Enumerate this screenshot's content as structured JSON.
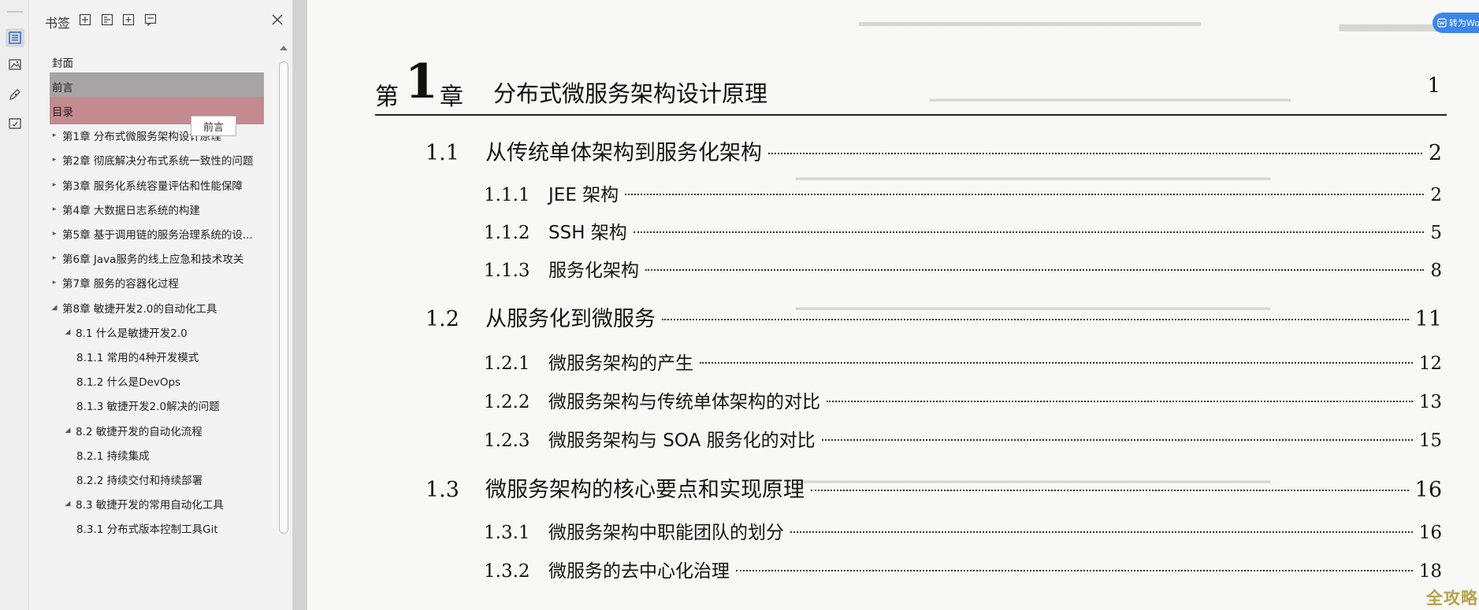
{
  "rail": {
    "icons": [
      "bookmark-outline-icon",
      "thumbnail-icon",
      "annotation-icon",
      "attachment-icon"
    ]
  },
  "bookmarks": {
    "title": "书签",
    "header_icons": [
      "expand-all-icon",
      "collapse-all-icon",
      "add-bookmark-icon",
      "bookmark-options-icon",
      "close-icon"
    ],
    "tooltip": "前言",
    "items": [
      {
        "label": "封面",
        "level": 0,
        "arrow": "",
        "state": "normal"
      },
      {
        "label": "前言",
        "level": 0,
        "arrow": "",
        "state": "highlighted"
      },
      {
        "label": "目录",
        "level": 0,
        "arrow": "",
        "state": "selected"
      },
      {
        "label": "第1章 分布式微服务架构设计原理",
        "level": 0,
        "arrow": "▸",
        "state": "normal"
      },
      {
        "label": "第2章 彻底解决分布式系统一致性的问题",
        "level": 0,
        "arrow": "▸",
        "state": "normal"
      },
      {
        "label": "第3章 服务化系统容量评估和性能保障",
        "level": 0,
        "arrow": "▸",
        "state": "normal"
      },
      {
        "label": "第4章 大数据日志系统的构建",
        "level": 0,
        "arrow": "▸",
        "state": "normal"
      },
      {
        "label": "第5章 基于调用链的服务治理系统的设...",
        "level": 0,
        "arrow": "▸",
        "state": "normal"
      },
      {
        "label": "第6章 Java服务的线上应急和技术攻关",
        "level": 0,
        "arrow": "▸",
        "state": "normal"
      },
      {
        "label": "第7章 服务的容器化过程",
        "level": 0,
        "arrow": "▸",
        "state": "normal"
      },
      {
        "label": "第8章 敏捷开发2.0的自动化工具",
        "level": 0,
        "arrow": "◢",
        "state": "normal"
      },
      {
        "label": "8.1 什么是敏捷开发2.0",
        "level": 1,
        "arrow": "◢",
        "state": "normal"
      },
      {
        "label": "8.1.1 常用的4种开发模式",
        "level": 2,
        "arrow": "",
        "state": "normal"
      },
      {
        "label": "8.1.2 什么是DevOps",
        "level": 2,
        "arrow": "",
        "state": "normal"
      },
      {
        "label": "8.1.3 敏捷开发2.0解决的问题",
        "level": 2,
        "arrow": "",
        "state": "normal"
      },
      {
        "label": "8.2 敏捷开发的自动化流程",
        "level": 1,
        "arrow": "◢",
        "state": "normal"
      },
      {
        "label": "8.2.1 持续集成",
        "level": 2,
        "arrow": "",
        "state": "normal"
      },
      {
        "label": "8.2.2 持续交付和持续部署",
        "level": 2,
        "arrow": "",
        "state": "normal"
      },
      {
        "label": "8.3 敏捷开发的常用自动化工具",
        "level": 1,
        "arrow": "◢",
        "state": "normal"
      },
      {
        "label": "8.3.1 分布式版本控制工具Git",
        "level": 2,
        "arrow": "",
        "state": "normal"
      }
    ]
  },
  "document": {
    "chapter": {
      "prefix": "第",
      "number": "1",
      "suffix": "章",
      "title": "分布式微服务架构设计原理",
      "page": "1"
    },
    "entries": [
      {
        "num": "1.1",
        "title": "从传统单体架构到服务化架构",
        "page": "2",
        "level": 1
      },
      {
        "num": "1.1.1",
        "title": "JEE 架构",
        "page": "2",
        "level": 2
      },
      {
        "num": "1.1.2",
        "title": "SSH 架构",
        "page": "5",
        "level": 2
      },
      {
        "num": "1.1.3",
        "title": "服务化架构",
        "page": "8",
        "level": 2
      },
      {
        "num": "1.2",
        "title": "从服务化到微服务",
        "page": "11",
        "level": 1
      },
      {
        "num": "1.2.1",
        "title": "微服务架构的产生",
        "page": "12",
        "level": 2
      },
      {
        "num": "1.2.2",
        "title": "微服务架构与传统单体架构的对比",
        "page": "13",
        "level": 2
      },
      {
        "num": "1.2.3",
        "title": "微服务架构与 SOA 服务化的对比",
        "page": "15",
        "level": 2
      },
      {
        "num": "1.3",
        "title": "微服务架构的核心要点和实现原理",
        "page": "16",
        "level": 1
      },
      {
        "num": "1.3.1",
        "title": "微服务架构中职能团队的划分",
        "page": "16",
        "level": 2
      },
      {
        "num": "1.3.2",
        "title": "微服务的去中心化治理",
        "page": "18",
        "level": 2
      }
    ]
  },
  "overlay": {
    "convert_button": "转为Wo",
    "watermark": "全攻略"
  },
  "colors": {
    "highlighted_bg": "#a8a3a4",
    "selected_bg": "#c38a90",
    "convert_button_bg": "#3b86e8",
    "watermark": "#b8a24a"
  }
}
